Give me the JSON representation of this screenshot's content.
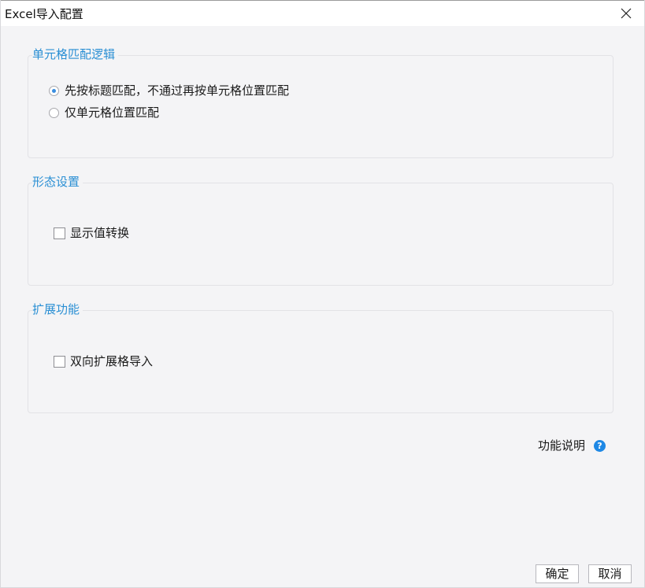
{
  "window": {
    "title": "Excel导入配置"
  },
  "icons": {
    "close": "close-icon",
    "help": "help-icon"
  },
  "groups": {
    "cell_match": {
      "legend": "单元格匹配逻辑",
      "options": [
        {
          "label": "先按标题匹配，不通过再按单元格位置匹配",
          "selected": true
        },
        {
          "label": "仅单元格位置匹配",
          "selected": false
        }
      ]
    },
    "display": {
      "legend": "形态设置",
      "checkbox_label": "显示值转换",
      "checked": false
    },
    "extension": {
      "legend": "扩展功能",
      "checkbox_label": "双向扩展格导入",
      "checked": false
    }
  },
  "help": {
    "label": "功能说明",
    "icon_glyph": "?"
  },
  "footer": {
    "ok_label": "确定",
    "cancel_label": "取消"
  },
  "colors": {
    "accent": "#2a8fd4",
    "help_icon": "#1e88e5",
    "background": "#f4f4f6"
  }
}
